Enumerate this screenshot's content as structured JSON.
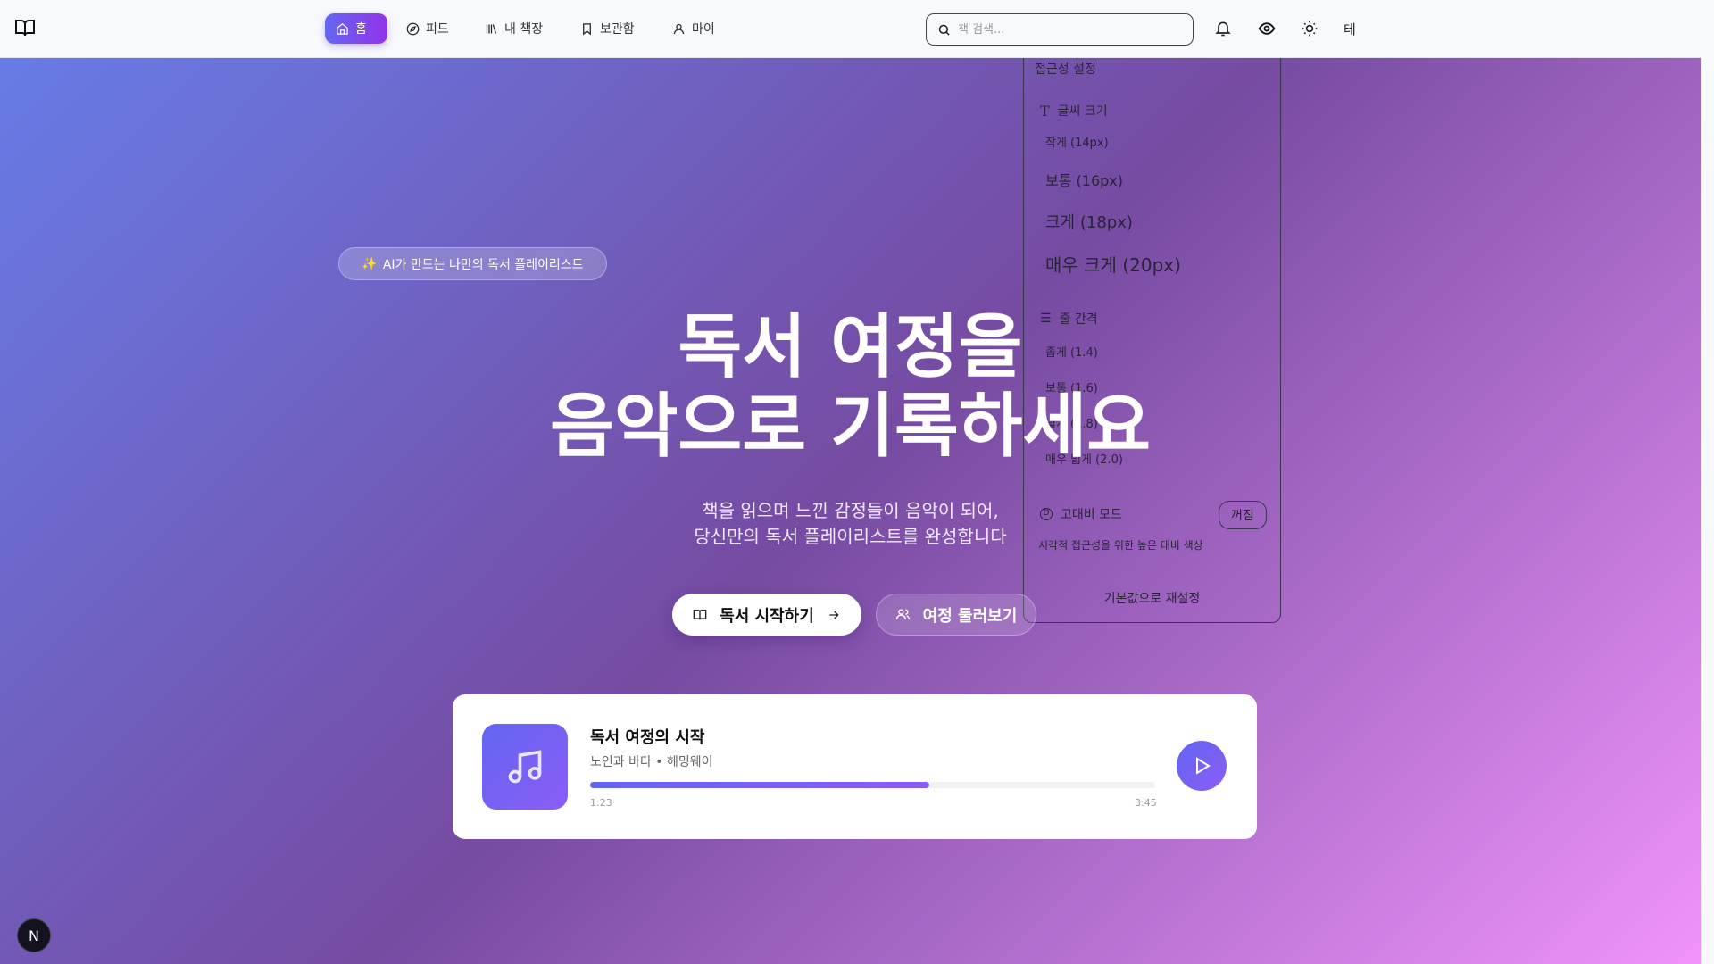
{
  "nav": {
    "items": [
      {
        "label": "홈",
        "icon": "home-icon",
        "active": true
      },
      {
        "label": "피드",
        "icon": "compass-icon"
      },
      {
        "label": "내 책장",
        "icon": "library-icon"
      },
      {
        "label": "보관함",
        "icon": "bookmark-icon"
      },
      {
        "label": "마이",
        "icon": "user-icon"
      }
    ],
    "search_placeholder": "책 검색...",
    "theme_label": "테"
  },
  "accessibility": {
    "title": "접근성 설정",
    "font_size_label": "글씨 크기",
    "font_sizes": [
      "작게 (14px)",
      "보통 (16px)",
      "크게 (18px)",
      "매우 크게 (20px)"
    ],
    "line_height_label": "줄 간격",
    "line_heights": [
      "좁게 (1.4)",
      "보통 (1.6)",
      "넓게 (1.8)",
      "매우 넓게 (2.0)"
    ],
    "high_contrast_label": "고대비 모드",
    "high_contrast_state": "꺼짐",
    "high_contrast_desc": "시각적 접근성을 위한 높은 대비 색상",
    "reset_label": "기본값으로 재설정"
  },
  "hero": {
    "badge": "AI가 만드는 나만의 독서 플레이리스트",
    "title_line1": "독서 여정을",
    "title_line2": "음악으로 기록하세요",
    "subtitle_line1": "책을 읽으며 느낀 감정들이 음악이 되어,",
    "subtitle_line2": "당신만의 독서 플레이리스트를 완성합니다",
    "primary_button": "독서 시작하기",
    "secondary_button": "여정 둘러보기"
  },
  "player": {
    "title": "독서 여정의 시작",
    "subtitle": "노인과 바다 • 헤밍웨이",
    "current_time": "1:23",
    "total_time": "3:45",
    "progress": 0.6
  },
  "dev_badge": "N",
  "colors": {
    "accent": "#6366f1",
    "accent2": "#8b5cf6",
    "bg_start": "#667eea",
    "bg_mid": "#764ba2",
    "bg_end": "#f093fb"
  }
}
